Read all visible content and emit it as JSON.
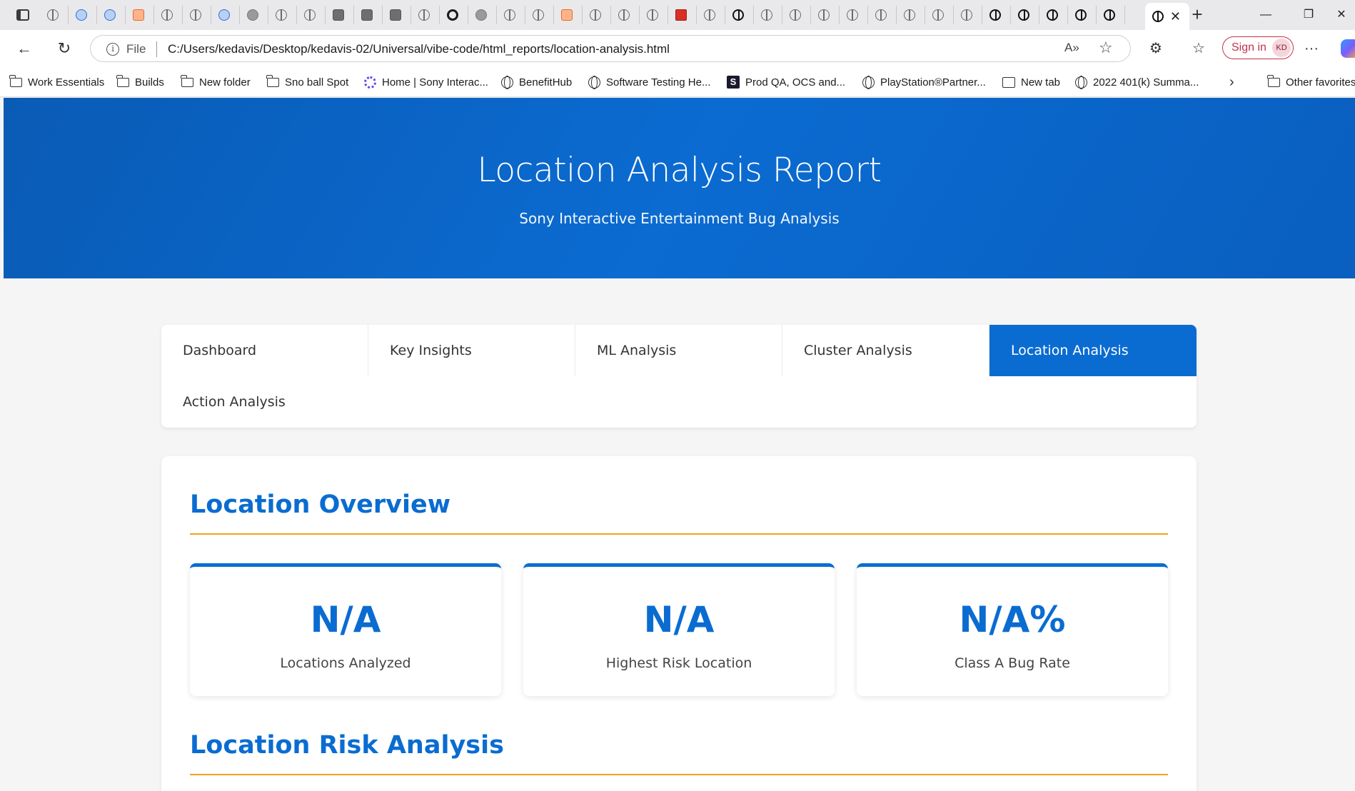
{
  "browser": {
    "active_tab_close": "✕",
    "new_tab": "+",
    "window_controls": {
      "minimize": "—",
      "restore": "❐",
      "close": "✕"
    },
    "address": {
      "scheme_label": "File",
      "url": "C:/Users/kedavis/Desktop/kedavis-02/Universal/vibe-code/html_reports/location-analysis.html"
    },
    "signin_label": "Sign in",
    "avatar_initials": "KD",
    "more_menu": "···",
    "bookmarks": [
      {
        "label": "Work Essentials",
        "icon": "folder-icon"
      },
      {
        "label": "Builds",
        "icon": "folder-icon"
      },
      {
        "label": "New folder",
        "icon": "folder-icon"
      },
      {
        "label": "Sno ball Spot",
        "icon": "folder-icon"
      },
      {
        "label": "Home | Sony Interac...",
        "icon": "sony-icon"
      },
      {
        "label": "BenefitHub",
        "icon": "globe-icon"
      },
      {
        "label": "Software Testing He...",
        "icon": "globe-icon"
      },
      {
        "label": "Prod QA, OCS and...",
        "icon": "s-logo-icon"
      },
      {
        "label": "PlayStation®Partner...",
        "icon": "globe-icon"
      },
      {
        "label": "New tab",
        "icon": "tab-icon"
      },
      {
        "label": "2022 401(k) Summa...",
        "icon": "globe-icon"
      },
      {
        "label": "Other favorites",
        "icon": "folder-icon"
      }
    ]
  },
  "page": {
    "title": "Location Analysis Report",
    "subtitle": "Sony Interactive Entertainment Bug Analysis",
    "nav_tabs": [
      {
        "label": "Dashboard",
        "active": false
      },
      {
        "label": "Key Insights",
        "active": false
      },
      {
        "label": "ML Analysis",
        "active": false
      },
      {
        "label": "Cluster Analysis",
        "active": false
      },
      {
        "label": "Location Analysis",
        "active": true
      },
      {
        "label": "Action Analysis",
        "active": false
      }
    ],
    "sections": {
      "overview_title": "Location Overview",
      "risk_title": "Location Risk Analysis"
    },
    "stats": [
      {
        "value": "N/A",
        "label": "Locations Analyzed"
      },
      {
        "value": "N/A",
        "label": "Highest Risk Location"
      },
      {
        "value": "N/A%",
        "label": "Class A Bug Rate"
      }
    ],
    "colors": {
      "accent": "#0a6cd1",
      "rule": "#f0a21e",
      "hero": "#0b6bd1"
    }
  }
}
